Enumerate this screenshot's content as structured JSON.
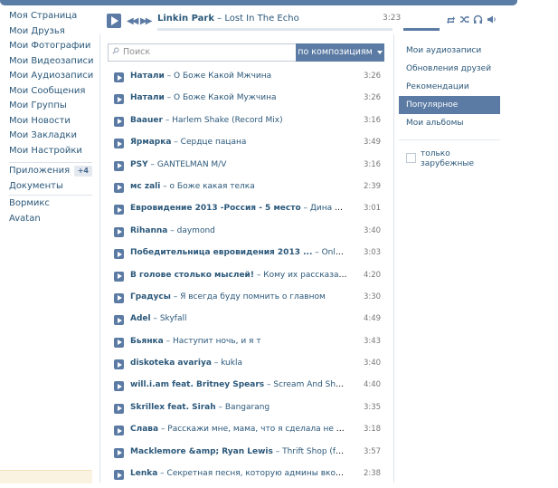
{
  "sidebar": {
    "items": [
      {
        "label": "Моя Страница"
      },
      {
        "label": "Мои Друзья"
      },
      {
        "label": "Мои Фотографии"
      },
      {
        "label": "Мои Видеозаписи"
      },
      {
        "label": "Мои Аудиозаписи"
      },
      {
        "label": "Мои Сообщения"
      },
      {
        "label": "Мои Группы"
      },
      {
        "label": "Мои Новости"
      },
      {
        "label": "Мои Закладки"
      },
      {
        "label": "Мои Настройки"
      }
    ],
    "apps": {
      "label": "Приложения",
      "badge": "+4"
    },
    "docs": {
      "label": "Документы"
    },
    "extra": [
      {
        "label": "Вормикс"
      },
      {
        "label": "Avatan"
      }
    ]
  },
  "player": {
    "artist": "Linkin Park",
    "sep": " – ",
    "title": "Lost In The Echo",
    "time": "3:23",
    "progress": 0.0,
    "volume": 1.0
  },
  "search": {
    "placeholder": "Поиск",
    "sort_label": "по композициям"
  },
  "tracks": [
    {
      "artist": "Натали",
      "title": "О Боже Какой Мжчина",
      "duration": "3:26"
    },
    {
      "artist": "Натали",
      "title": "О Боже Какой Мужчина",
      "duration": "3:26"
    },
    {
      "artist": "Baauer",
      "title": "Harlem Shake (Record Mix)",
      "duration": "3:16"
    },
    {
      "artist": "Ярмарка",
      "title": "Сердце пацана",
      "duration": "3:49"
    },
    {
      "artist": "PSY",
      "title": "GANTELMAN M/V",
      "duration": "3:16"
    },
    {
      "artist": "мс zali",
      "title": "о Боже какая телка",
      "duration": "2:39"
    },
    {
      "artist": "Евровидение 2013 -Россия - 5 место",
      "title": "Дина Гарипова ...",
      "duration": "3:01"
    },
    {
      "artist": "Rihanna",
      "title": "daymond",
      "duration": "3:40"
    },
    {
      "artist": "Победительница евровидения 2013 ...",
      "title": "Only Teardrops",
      "duration": "3:03"
    },
    {
      "artist": "В голове столько мыслей!",
      "title": "Кому их рассказать?!",
      "duration": "4:20"
    },
    {
      "artist": "Градусы",
      "title": "Я всегда буду помнить о главном",
      "duration": "3:30"
    },
    {
      "artist": "Adel",
      "title": "Skyfall",
      "duration": "4:49"
    },
    {
      "artist": "Бьянка",
      "title": "Наступит ночь, и я т",
      "duration": "3:43"
    },
    {
      "artist": "diskoteka avariya",
      "title": "kukla",
      "duration": "3:40"
    },
    {
      "artist": "will.i.am feat. Britney Spears",
      "title": "Scream And Shout",
      "duration": "4:40"
    },
    {
      "artist": "Skrillex feat. Sirah",
      "title": "Bangarang",
      "duration": "3:35"
    },
    {
      "artist": "Слава",
      "title": "Расскажи мне, мама, что я сделала не так...",
      "duration": "3:18"
    },
    {
      "artist": "Macklemore &amp; Ryan Lewis",
      "title": "Thrift Shop (feat. Wanz)",
      "duration": "3:57"
    },
    {
      "artist": "Lenka",
      "title": "Секретная песня, которую админы вконтакте н...",
      "duration": "2:38"
    }
  ],
  "right": {
    "items": [
      {
        "label": "Мои аудиозаписи",
        "active": false
      },
      {
        "label": "Обновления друзей",
        "active": false
      },
      {
        "label": "Рекомендации",
        "active": false
      },
      {
        "label": "Популярное",
        "active": true
      },
      {
        "label": "Мои альбомы",
        "active": false
      }
    ],
    "foreign_only": {
      "label": "только зарубежные",
      "checked": false
    }
  },
  "colors": {
    "accent": "#5b7ba4",
    "link": "#2b587a",
    "border": "#dde3ea"
  },
  "icons": {
    "play": "play-icon",
    "prev": "prev-icon",
    "next": "next-icon",
    "repeat": "repeat-icon",
    "shuffle": "shuffle-icon",
    "headphones": "headphones-icon",
    "broadcast": "broadcast-icon",
    "search": "search-icon"
  }
}
